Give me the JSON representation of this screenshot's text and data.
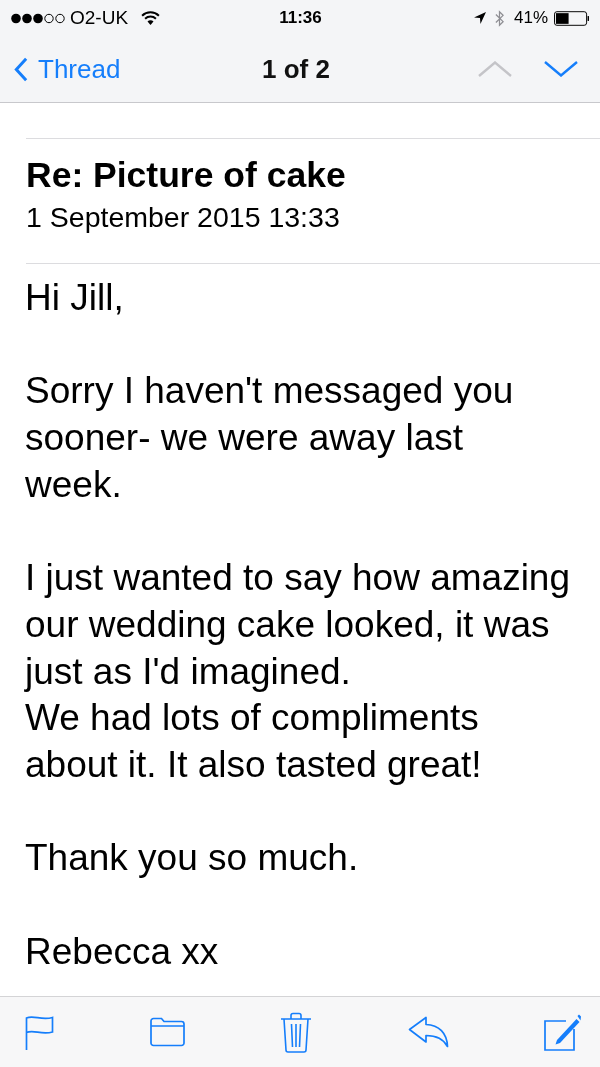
{
  "status_bar": {
    "carrier": "O2-UK",
    "time": "11:36",
    "battery": "41%"
  },
  "nav": {
    "back": "Thread",
    "title": "1 of 2",
    "previous_disabled": true,
    "next_disabled": false
  },
  "message": {
    "subject": "Re: Picture of cake",
    "date": "1 September 2015 13:33"
  },
  "body": [
    [
      "Hi Jill,"
    ],
    [
      "Sorry I haven't messaged you\nsooner- we were away last\nweek."
    ],
    [
      "I just wanted to say how amazing\nour wedding cake looked, it was\njust as I'd imagined.",
      "We had lots of compliments\nabout it. It also tasted great!"
    ],
    [
      "Thank you so much."
    ],
    [
      "Rebecca xx"
    ]
  ]
}
